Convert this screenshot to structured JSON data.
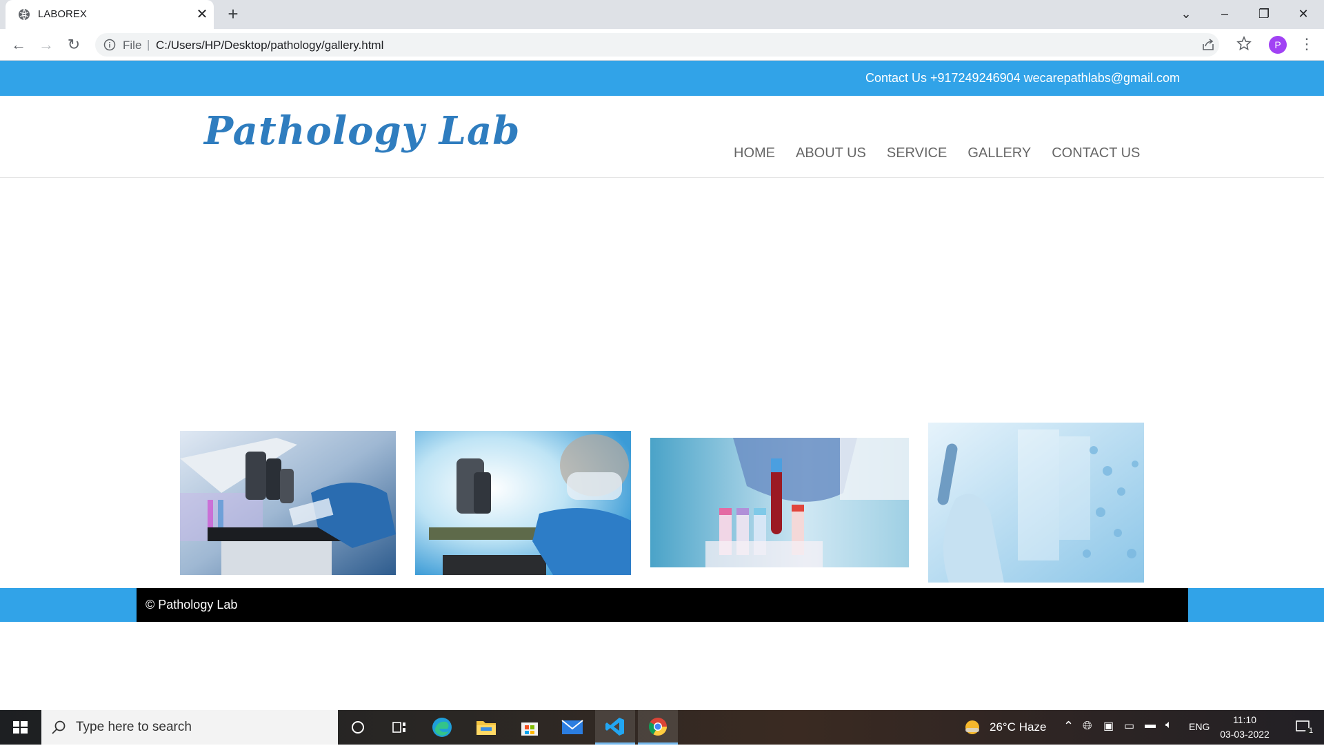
{
  "browser": {
    "tab_title": "LABOREX",
    "tab_close": "✕",
    "new_tab": "+",
    "address_prefix": "File",
    "address_separator": "|",
    "url": "C:/Users/HP/Desktop/pathology/gallery.html",
    "profile_initial": "P"
  },
  "site": {
    "contact_bar": "Contact Us +917249246904 wecarepathlabs@gmail.com",
    "logo": "Pathology Lab",
    "nav": [
      "HOME",
      "ABOUT US",
      "SERVICE",
      "GALLERY",
      "CONTACT US"
    ],
    "gallery": [
      {
        "name": "microscope-slide-photo"
      },
      {
        "name": "scientist-microscope-photo"
      },
      {
        "name": "blood-sample-tubes-photo"
      },
      {
        "name": "test-tube-dna-photo"
      }
    ],
    "footer": "© Pathology Lab"
  },
  "taskbar": {
    "search_placeholder": "Type here to search",
    "weather": "26°C  Haze",
    "language": "ENG",
    "time": "11:10",
    "date": "03-03-2022",
    "notification_count": "1"
  },
  "colors": {
    "accent_blue": "#31a3e8",
    "logo_blue": "#2f7dbf",
    "nav_text": "#666666",
    "footer_black": "#000000"
  }
}
